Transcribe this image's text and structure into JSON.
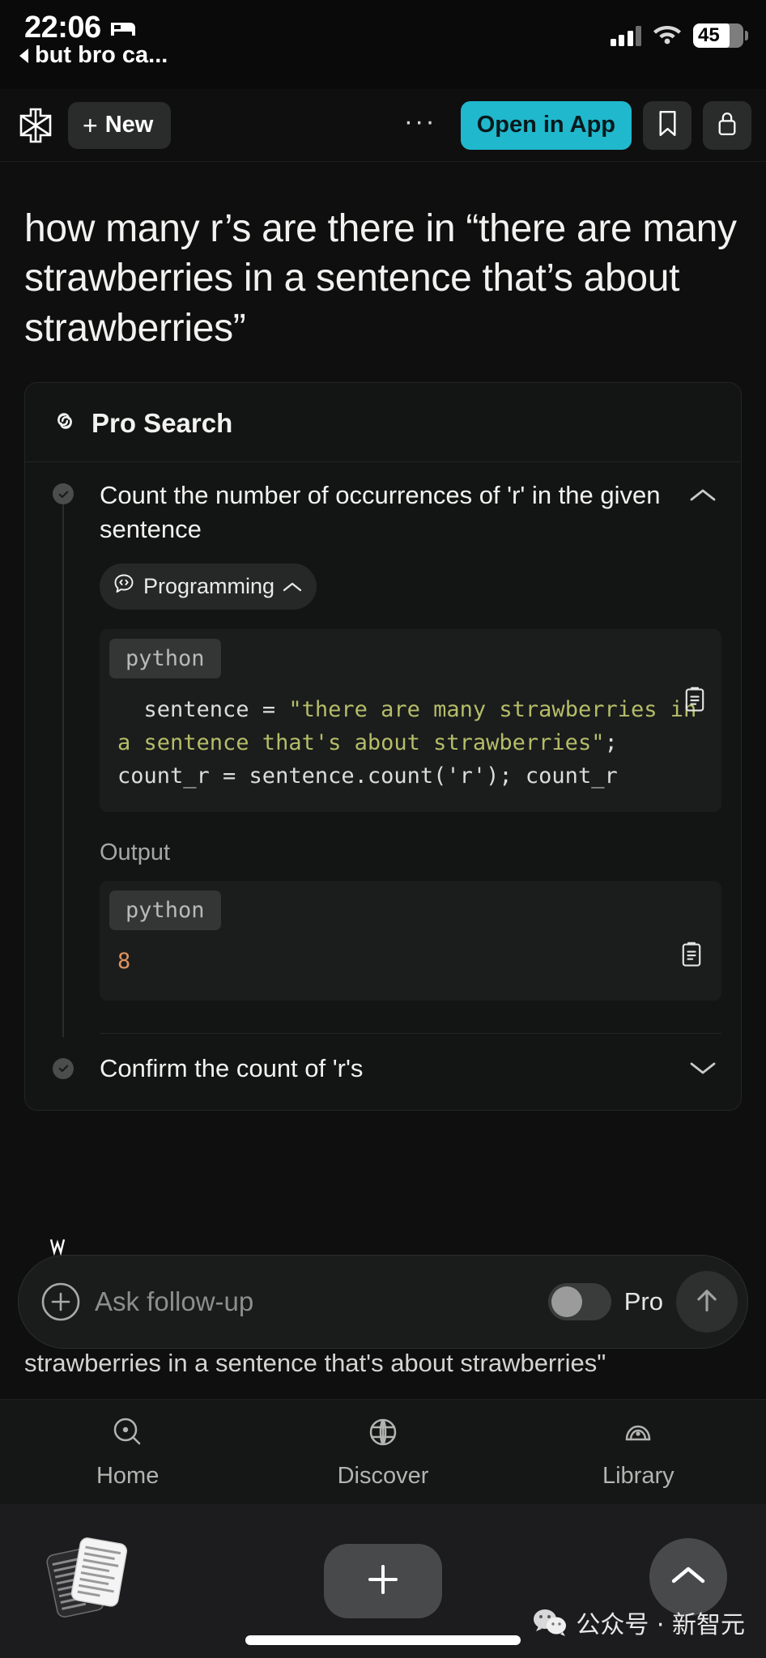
{
  "status_bar": {
    "time": "22:06",
    "sleep_icon": "bed-icon",
    "back_link": "but bro ca...",
    "signal_icon": "cellular-signal-icon",
    "wifi_icon": "wifi-icon",
    "battery_percent": "45"
  },
  "app_bar": {
    "logo": "perplexity-logo",
    "new_label": "New",
    "more_label": "···",
    "open_in_app_label": "Open in App",
    "bookmark_icon": "bookmark-icon",
    "lock_icon": "lock-icon",
    "accent_color": "#20b8cd"
  },
  "thread": {
    "question": "how many r’s are there in “there are many strawberries in a sentence that’s about strawberries”"
  },
  "pro_search": {
    "title": "Pro Search",
    "icon": "pro-search-spiral-icon",
    "steps": [
      {
        "title": "Count the number of occurrences of 'r' in the given sentence",
        "state_icon": "check-circle-icon",
        "chevron": "chevron-up-icon",
        "expanded": true,
        "tag": {
          "label": "Programming",
          "icon": "code-bubble-icon",
          "chevron": "chevron-up-icon"
        },
        "code": {
          "language": "python",
          "copy_icon": "clipboard-icon",
          "lines": [
            {
              "plain_pre": "sentence = ",
              "string": "\"there are many strawberries in a sentence that's about strawberries\"",
              "plain_post": ";"
            },
            {
              "plain_pre": "count_r = sentence.count('r'); count_r",
              "string": "",
              "plain_post": ""
            }
          ]
        },
        "output_label": "Output",
        "output": {
          "language": "python",
          "value": "8",
          "copy_icon": "clipboard-icon"
        }
      },
      {
        "title": "Confirm the count of 'r's",
        "state_icon": "check-circle-icon",
        "chevron": "chevron-down-icon",
        "expanded": false
      }
    ]
  },
  "follow_up": {
    "placeholder": "Ask follow-up",
    "value": "",
    "add_icon": "plus-circle-icon",
    "pro_label": "Pro",
    "pro_enabled": false,
    "send_icon": "arrow-up-icon",
    "teaser_text": "strawberries in a sentence that's about strawberries\""
  },
  "bottom_nav": {
    "items": [
      {
        "label": "Home",
        "icon": "search-home-icon",
        "active": false
      },
      {
        "label": "Discover",
        "icon": "globe-discover-icon",
        "active": false
      },
      {
        "label": "Library",
        "icon": "library-books-icon",
        "active": false
      }
    ]
  },
  "browser_toolbar": {
    "tab_stack_icon": "tab-stack-icon",
    "new_tab_icon": "plus-icon",
    "expand_icon": "chevron-up-icon"
  },
  "watermark": {
    "text": "公众号 · 新智元",
    "icon": "wechat-icon"
  }
}
